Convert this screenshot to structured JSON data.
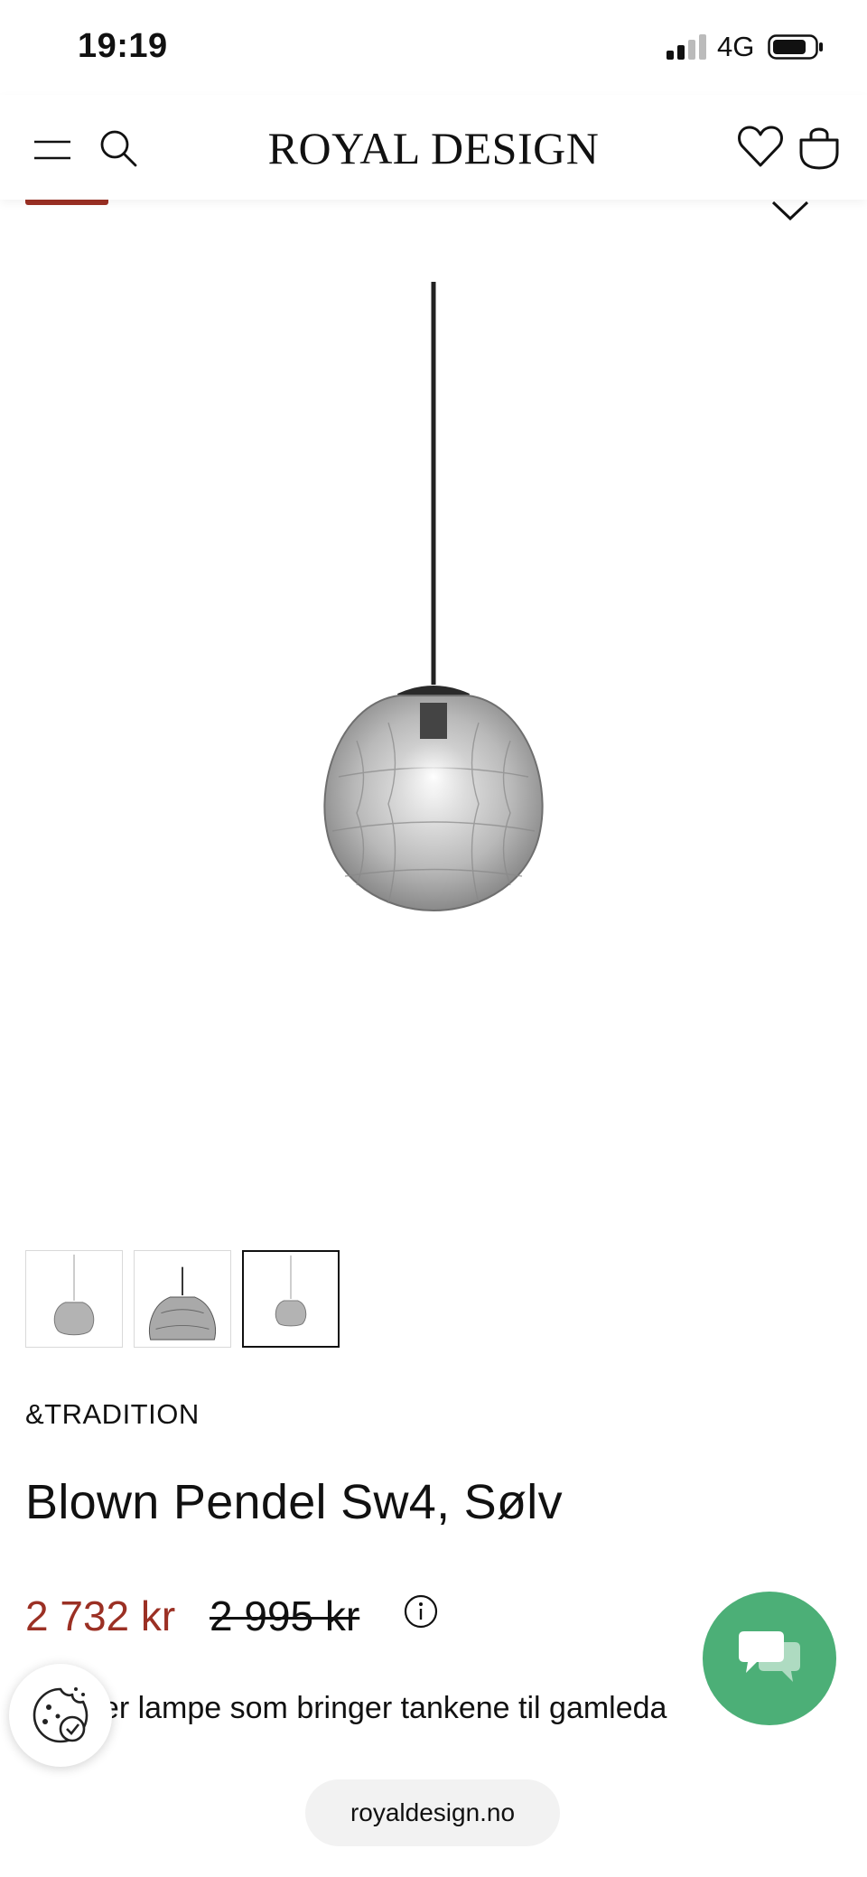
{
  "status_bar": {
    "time": "19:19",
    "network": "4G",
    "icons": [
      "signal-icon",
      "battery-icon"
    ]
  },
  "header": {
    "logo": "ROYAL DESIGN",
    "icons": [
      "menu-icon",
      "search-icon",
      "heart-icon",
      "bag-icon"
    ]
  },
  "gallery": {
    "thumbnails": [
      {
        "label": "thumbnail-1",
        "active": false
      },
      {
        "label": "thumbnail-2",
        "active": false
      },
      {
        "label": "thumbnail-3",
        "active": true
      }
    ]
  },
  "product": {
    "brand": "&TRADITION",
    "title": "Blown Pendel Sw4, Sølv",
    "price": "2 732 kr",
    "old_price": "2 995 kr",
    "description": "ekker lampe som bringer tankene til gamleda"
  },
  "footer": {
    "url": "royaldesign.no"
  },
  "colors": {
    "accent_red": "#9b3024",
    "chat_green": "#4caf77"
  }
}
